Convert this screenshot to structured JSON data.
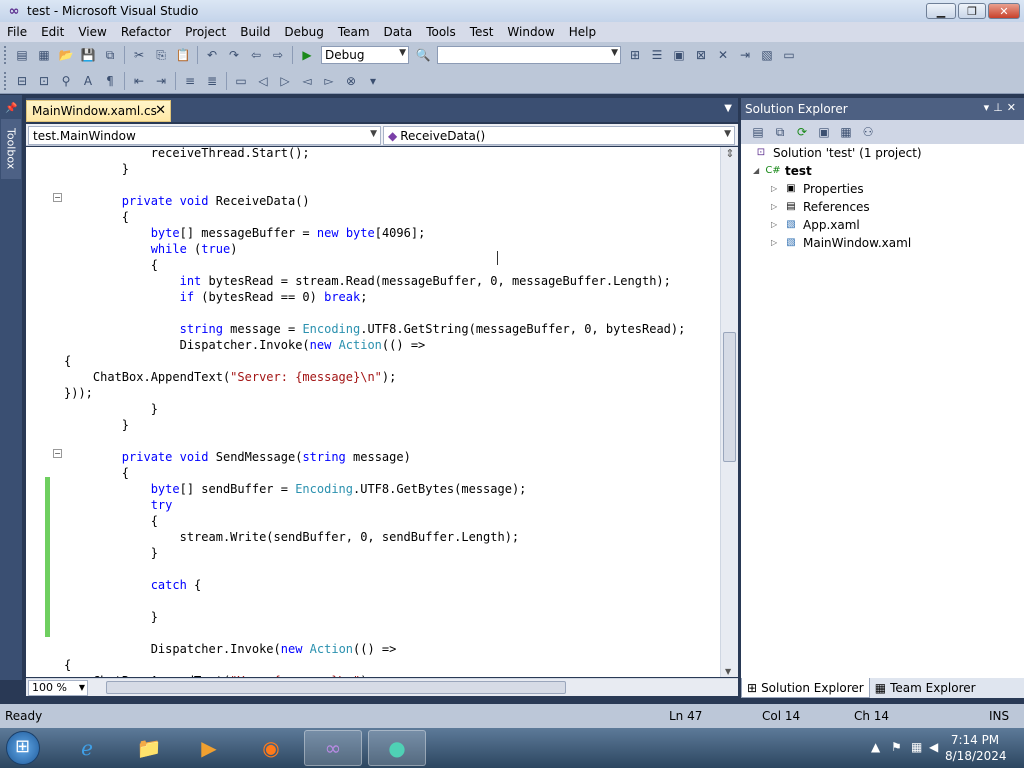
{
  "window": {
    "title": "test - Microsoft Visual Studio"
  },
  "menu": [
    "File",
    "Edit",
    "View",
    "Refactor",
    "Project",
    "Build",
    "Debug",
    "Team",
    "Data",
    "Tools",
    "Test",
    "Window",
    "Help"
  ],
  "toolbar": {
    "config_value": "Debug",
    "search_value": ""
  },
  "toolbox": {
    "label": "Toolbox"
  },
  "document_tab": {
    "label": "MainWindow.xaml.cs"
  },
  "nav": {
    "class_value": "test.MainWindow",
    "method_value": "ReceiveData()"
  },
  "code_lines": [
    "            receiveThread.Start();",
    "        }",
    "",
    "        private void ReceiveData()",
    "        {",
    "            byte[] messageBuffer = new byte[4096];",
    "            while (true)",
    "            {",
    "                int bytesRead = stream.Read(messageBuffer, 0, messageBuffer.Length);",
    "                if (bytesRead == 0) break;",
    "",
    "                string message = Encoding.UTF8.GetString(messageBuffer, 0, bytesRead);",
    "                Dispatcher.Invoke(new Action(() =>",
    "{",
    "    ChatBox.AppendText(\"Server: {message}\\n\");",
    "}));",
    "            }",
    "        }",
    "",
    "        private void SendMessage(string message)",
    "        {",
    "            byte[] sendBuffer = Encoding.UTF8.GetBytes(message);",
    "            try",
    "            {",
    "                stream.Write(sendBuffer, 0, sendBuffer.Length);",
    "            }",
    "",
    "            catch {",
    "",
    "            }",
    "",
    "            Dispatcher.Invoke(new Action(() =>",
    "{",
    "    ChatBox.AppendText(\"You: {message}\\n\");"
  ],
  "editor": {
    "zoom": "100 %"
  },
  "solution_explorer": {
    "title": "Solution Explorer",
    "solution_label": "Solution 'test' (1 project)",
    "project_label": "test",
    "items": [
      "Properties",
      "References",
      "App.xaml",
      "MainWindow.xaml"
    ],
    "tabs": [
      "Solution Explorer",
      "Team Explorer"
    ]
  },
  "status": {
    "ready": "Ready",
    "ln": "Ln 47",
    "col": "Col 14",
    "ch": "Ch 14",
    "ins": "INS"
  },
  "taskbar": {
    "time": "7:14 PM",
    "date": "8/18/2024"
  },
  "colors": {
    "keyword": "#0000ff",
    "type": "#2b91af",
    "string": "#a31515",
    "chrome": "#293955"
  }
}
